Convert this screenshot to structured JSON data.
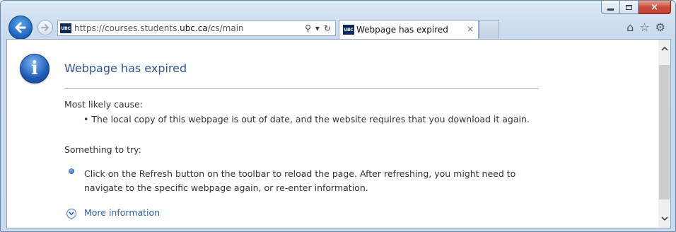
{
  "window": {
    "caption": {
      "minimize": "minimize",
      "maximize": "maximize",
      "close": "×"
    }
  },
  "nav": {
    "back_icon": "back-arrow-icon",
    "forward_icon": "forward-arrow-icon"
  },
  "address": {
    "favicon_text": "UBC",
    "url_prefix": "https://courses.students.",
    "url_domain": "ubc.ca",
    "url_suffix": "/cs/main",
    "search_icon": "⚲",
    "dropdown_icon": "▾",
    "refresh_icon": "↻"
  },
  "tab": {
    "favicon_text": "UBC",
    "title": "Webpage has expired",
    "close": "×"
  },
  "toolbar": {
    "home_icon": "⌂",
    "favorites_icon": "☆",
    "settings_icon": "⚙"
  },
  "page": {
    "heading": "Webpage has expired",
    "cause_label": "Most likely cause:",
    "cause_item": "•  The local copy of this webpage is out of date, and the website requires that you download it again.",
    "try_label": "Something to try:",
    "suggestion": "Click on the Refresh button on the toolbar to reload the page. After refreshing, you might need to navigate to the specific webpage again, or re-enter information.",
    "more_info": "More information"
  },
  "scrollbar": {
    "up": "︿",
    "down": "﹀"
  }
}
